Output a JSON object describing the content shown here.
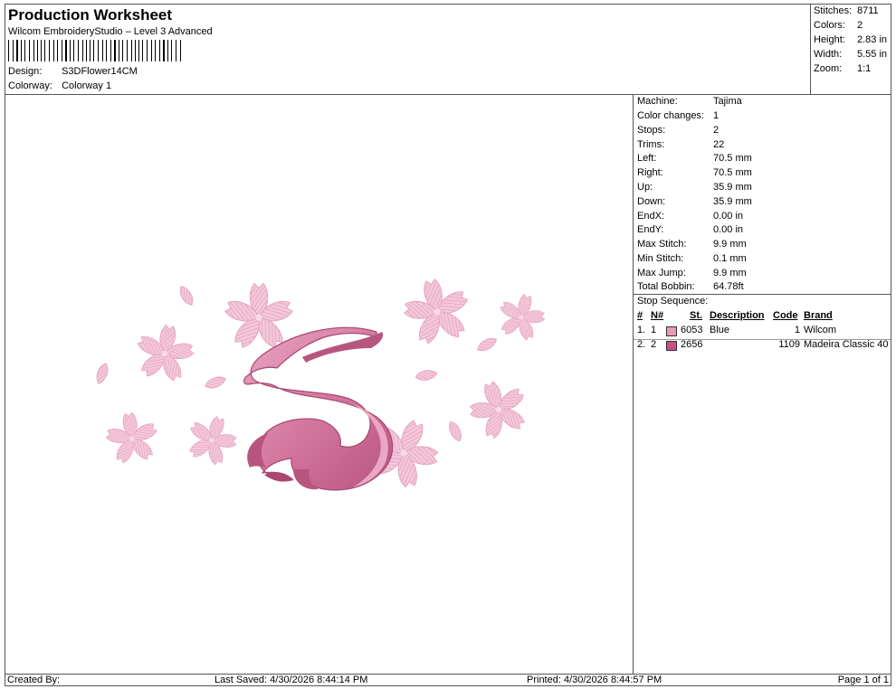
{
  "header": {
    "title": "Production Worksheet",
    "subtitle": "Wilcom EmbroideryStudio – Level 3 Advanced",
    "design_label": "Design:",
    "design_value": "S3DFlower14CM",
    "colorway_label": "Colorway:",
    "colorway_value": "Colorway 1"
  },
  "summary": [
    {
      "label": "Stitches:",
      "value": "8711"
    },
    {
      "label": "Colors:",
      "value": "2"
    },
    {
      "label": "Height:",
      "value": "2.83 in"
    },
    {
      "label": "Width:",
      "value": "5.55 in"
    },
    {
      "label": "Zoom:",
      "value": "1:1"
    }
  ],
  "machine_info": [
    {
      "label": "Machine:",
      "value": "Tajima"
    },
    {
      "label": "Color changes:",
      "value": "1"
    },
    {
      "label": "Stops:",
      "value": "2"
    },
    {
      "label": "Trims:",
      "value": "22"
    },
    {
      "label": "Left:",
      "value": "70.5 mm"
    },
    {
      "label": "Right:",
      "value": "70.5 mm"
    },
    {
      "label": "Up:",
      "value": "35.9 mm"
    },
    {
      "label": "Down:",
      "value": "35.9 mm"
    },
    {
      "label": "EndX:",
      "value": "0.00 in"
    },
    {
      "label": "EndY:",
      "value": "0.00 in"
    },
    {
      "label": "Max Stitch:",
      "value": "9.9 mm"
    },
    {
      "label": "Min Stitch:",
      "value": "0.1 mm"
    },
    {
      "label": "Max Jump:",
      "value": "9.9 mm"
    },
    {
      "label": "Total Bobbin:",
      "value": "64.78ft"
    }
  ],
  "stop_sequence": {
    "title": "Stop Sequence:",
    "headers": {
      "num": "#",
      "n": "N#",
      "st": "St.",
      "description": "Description",
      "code": "Code",
      "brand": "Brand"
    },
    "rows": [
      {
        "num": "1.",
        "n": "1",
        "swatch": "#e79ab8",
        "st": "6053",
        "description": "Blue",
        "code": "1",
        "brand": "Wilcom"
      },
      {
        "num": "2.",
        "n": "2",
        "swatch": "#c94f85",
        "st": "2656",
        "description": "",
        "code": "1109",
        "brand": "Madeira Classic 40"
      }
    ]
  },
  "colors": {
    "petal_light": "#f2c3d6",
    "petal_mid": "#e79ab8",
    "letter_main": "#d4779e",
    "letter_dark": "#a94672",
    "letter_light": "#e9a7c3"
  },
  "footer": {
    "created_by": "Created By:",
    "last_saved": "Last Saved: 4/30/2026 8:44:14 PM",
    "printed": "Printed: 4/30/2026 8:44:57 PM",
    "page": "Page 1 of 1"
  }
}
